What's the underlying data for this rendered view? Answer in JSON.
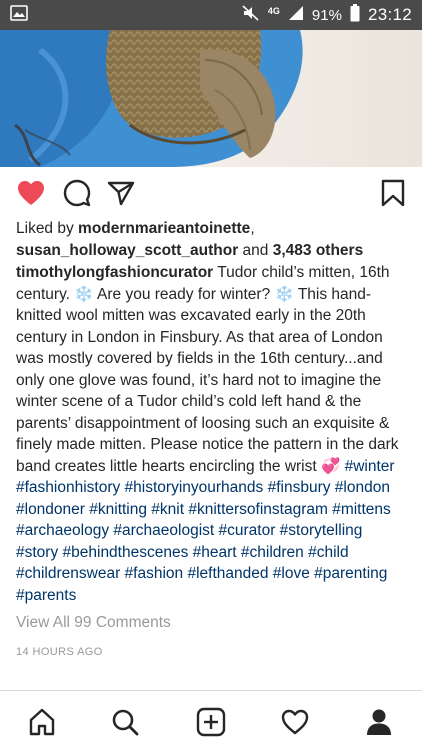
{
  "status_bar": {
    "network": "4G",
    "battery": "91%",
    "time": "23:12"
  },
  "post": {
    "liked_by_prefix": "Liked by ",
    "liker_1": "modernmarieantoinette",
    "separator": ",",
    "liker_2": "susan_holloway_scott_author",
    "and_text": " and ",
    "others_count": "3,483 others",
    "caption_user": "timothylongfashioncurator",
    "caption_text": " Tudor child’s mitten, 16th century. ❄️ Are you ready for winter? ❄️ This hand-knitted wool mitten was excavated early in the 20th century in London in Finsbury. As that area of London was mostly covered by fields in the 16th century...and only one glove was found, it’s hard not to imagine the winter scene of a Tudor child’s cold left hand & the parents’ disappointment of loosing such an exquisite & finely made mitten. Please notice the pattern in the dark band creates little hearts encircling the wrist 💞",
    "hashtags": "#winter #fashionhistory #historyinyourhands #finsbury #london #londoner #knitting #knit #knittersofinstagram #mittens #archaeology #archaeologist #curator #storytelling #story #behindthescenes #heart #children #child #childrenswear #fashion #lefthanded #love #parenting #parents",
    "view_all_comments": "View All 99 Comments",
    "timestamp": "14 HOURS AGO",
    "liked": true
  },
  "icons": {
    "like": "heart-filled-icon",
    "comment": "comment-icon",
    "share": "send-icon",
    "save": "bookmark-icon",
    "nav": [
      "home-icon",
      "search-icon",
      "add-icon",
      "activity-heart-icon",
      "profile-icon"
    ]
  },
  "colors": {
    "like_red": "#ed4956",
    "hashtag_blue": "#003569",
    "muted_gray": "#999999",
    "status_bar_bg": "#4a4a4a",
    "photo_bg_blue": "#3f8fd3"
  }
}
